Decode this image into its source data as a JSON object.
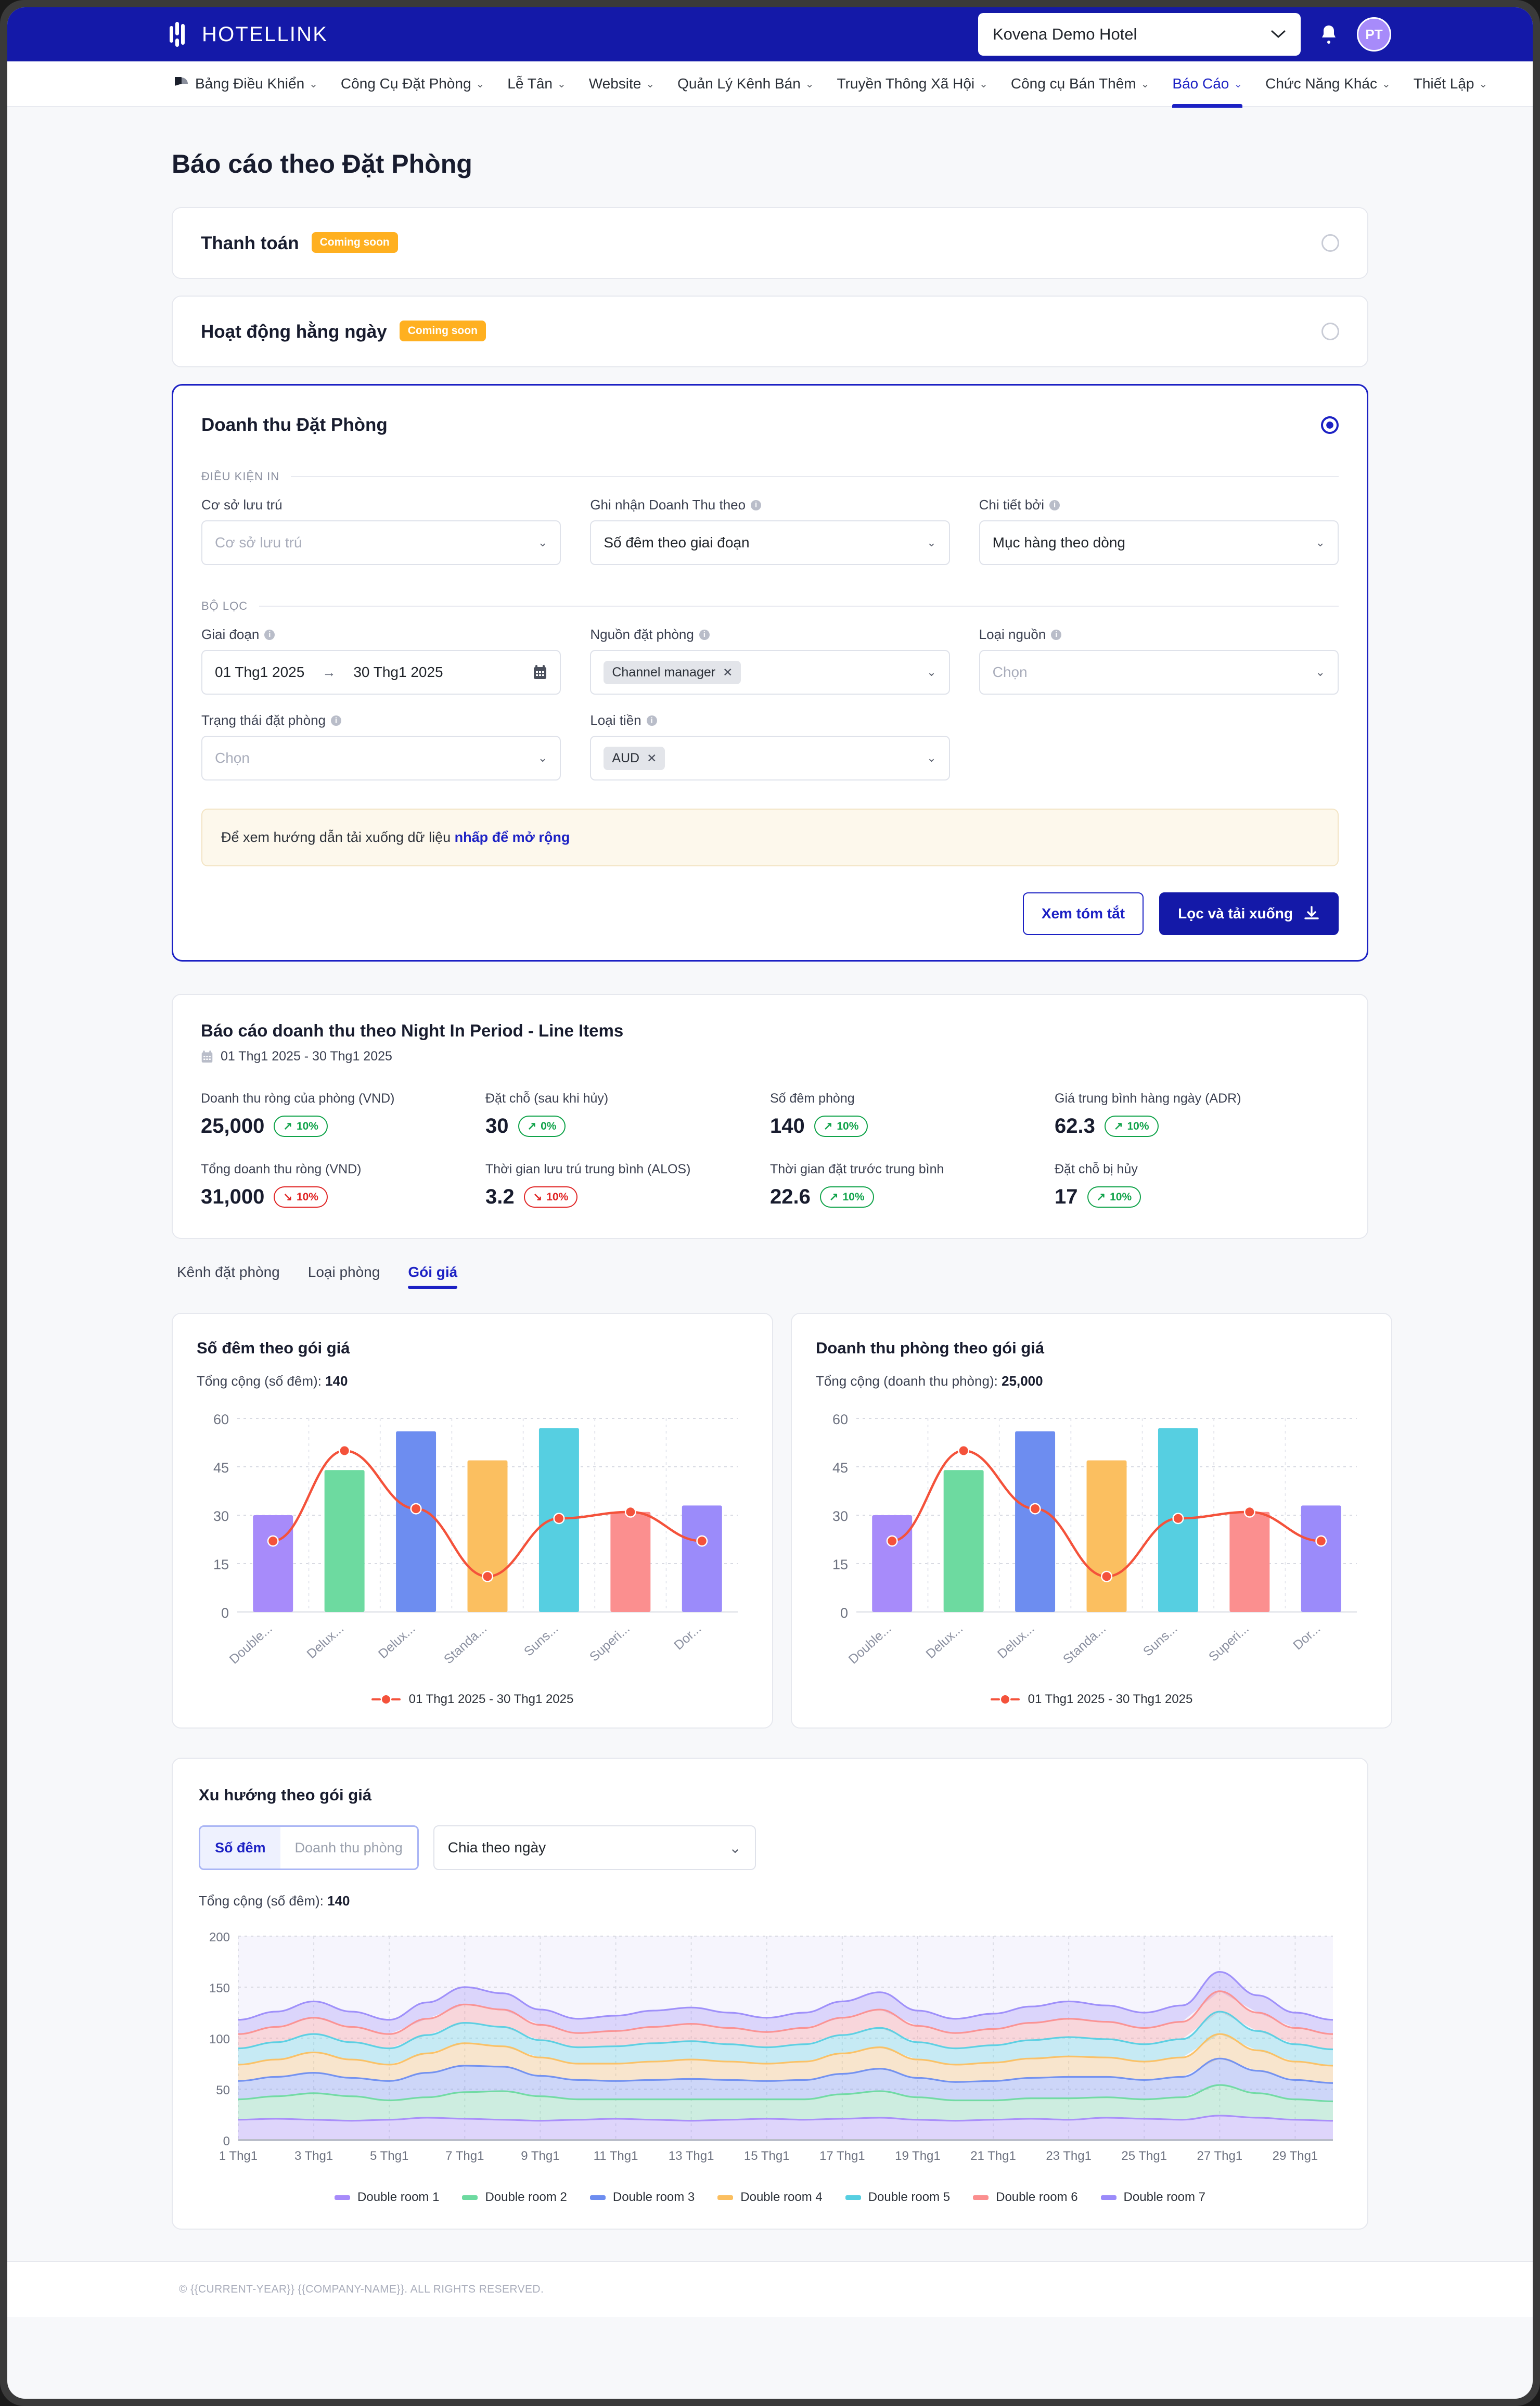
{
  "topbar": {
    "brand": "HOTELLINK",
    "hotel_selected": "Kovena Demo Hotel",
    "avatar_initials": "PT"
  },
  "nav": {
    "items": [
      {
        "label": "Bảng Điều Khiển",
        "caret": true,
        "icon": "dashboard-pie-icon",
        "active": false
      },
      {
        "label": "Công Cụ Đặt Phòng",
        "caret": true,
        "active": false
      },
      {
        "label": "Lễ Tân",
        "caret": true,
        "active": false
      },
      {
        "label": "Website",
        "caret": true,
        "active": false
      },
      {
        "label": "Quản Lý Kênh Bán",
        "caret": true,
        "active": false
      },
      {
        "label": "Truyền Thông Xã Hội",
        "caret": true,
        "active": false
      },
      {
        "label": "Công cụ Bán Thêm",
        "caret": true,
        "active": false
      },
      {
        "label": "Báo Cáo",
        "caret": true,
        "active": true
      },
      {
        "label": "Chức Năng Khác",
        "caret": true,
        "active": false
      },
      {
        "label": "Thiết Lập",
        "caret": true,
        "active": false
      }
    ]
  },
  "page": {
    "title": "Báo cáo theo Đặt Phòng"
  },
  "accordions": [
    {
      "title": "Thanh toán",
      "badge": "Coming soon",
      "selected": false
    },
    {
      "title": "Hoạt động hằng ngày",
      "badge": "Coming soon",
      "selected": false
    }
  ],
  "panel": {
    "title": "Doanh thu Đặt Phòng",
    "selected": true,
    "print_legend": "ĐIỀU KIỆN IN",
    "filter_legend": "BỘ LỌC",
    "fields": {
      "property": {
        "label": "Cơ sở lưu trú",
        "placeholder": "Cơ sở lưu trú",
        "value": ""
      },
      "revenue_basis": {
        "label": "Ghi nhận Doanh Thu theo",
        "value": "Số đêm theo giai đoạn",
        "info": true
      },
      "detail_by": {
        "label": "Chi tiết bởi",
        "value": "Mục hàng theo dòng",
        "info": true
      },
      "period": {
        "label": "Giai đoạn",
        "info": true,
        "start": "01 Thg1 2025",
        "end": "30 Thg1 2025",
        "arrow": "→"
      },
      "booking_source": {
        "label": "Nguồn đặt phòng",
        "info": true,
        "chips": [
          "Channel manager"
        ]
      },
      "source_type": {
        "label": "Loại nguồn",
        "info": true,
        "placeholder": "Chọn",
        "value": ""
      },
      "booking_status": {
        "label": "Trạng thái đặt phòng",
        "info": true,
        "placeholder": "Chọn",
        "value": ""
      },
      "currency": {
        "label": "Loại tiền",
        "info": true,
        "chips": [
          "AUD"
        ]
      }
    },
    "notice": {
      "text": "Để xem hướng dẫn tải xuống dữ liệu ",
      "link": "nhấp để mở rộng"
    },
    "buttons": {
      "summary": "Xem tóm tắt",
      "download": "Lọc và tải xuống"
    }
  },
  "summary": {
    "title": "Báo cáo doanh thu theo Night In Period - Line Items",
    "date_range": "01 Thg1 2025 - 30 Thg1 2025",
    "kpis": [
      {
        "label": "Doanh thu ròng của phòng (VND)",
        "value": "25,000",
        "delta": "10%",
        "dir": "up"
      },
      {
        "label": "Đặt chỗ (sau khi hủy)",
        "value": "30",
        "delta": "0%",
        "dir": "up"
      },
      {
        "label": "Số đêm phòng",
        "value": "140",
        "delta": "10%",
        "dir": "up"
      },
      {
        "label": "Giá trung bình hàng ngày (ADR)",
        "value": "62.3",
        "delta": "10%",
        "dir": "up"
      },
      {
        "label": "Tổng doanh thu ròng (VND)",
        "value": "31,000",
        "delta": "10%",
        "dir": "down"
      },
      {
        "label": "Thời gian lưu trú trung bình (ALOS)",
        "value": "3.2",
        "delta": "10%",
        "dir": "down"
      },
      {
        "label": "Thời gian đặt trước trung bình",
        "value": "22.6",
        "delta": "10%",
        "dir": "up"
      },
      {
        "label": "Đặt chỗ bị hủy",
        "value": "17",
        "delta": "10%",
        "dir": "up"
      }
    ]
  },
  "tabs": [
    {
      "label": "Kênh đặt phòng",
      "active": false
    },
    {
      "label": "Loại phòng",
      "active": false
    },
    {
      "label": "Gói giá",
      "active": true
    }
  ],
  "trend": {
    "title": "Xu hướng theo gói giá",
    "segmented": [
      {
        "label": "Số đêm",
        "active": true
      },
      {
        "label": "Doanh thu phòng",
        "active": false
      }
    ],
    "granularity": "Chia theo ngày",
    "total_label": "Tổng cộng (số đêm):",
    "total_value": "140"
  },
  "footer": "© {{CURRENT-YEAR}} {{COMPANY-NAME}}. ALL RIGHTS RESERVED.",
  "chart_data": [
    {
      "type": "bar",
      "title": "Số đêm theo gói giá",
      "total_label": "Tổng cộng (số đêm):",
      "total_value": "140",
      "categories": [
        "Double...",
        "Delux...",
        "Delux...",
        "Standa...",
        "Suns...",
        "Superi...",
        "Dor..."
      ],
      "values": [
        30,
        44,
        56,
        47,
        57,
        31,
        33
      ],
      "bar_colors": [
        "#a78bfa",
        "#6ddaa0",
        "#6d8df0",
        "#fbbf60",
        "#56cfe1",
        "#fb8f8f",
        "#9b8bfa"
      ],
      "line_name": "01 Thg1 2025 - 30 Thg1 2025",
      "line_color": "#f4523b",
      "line_values": [
        22,
        50,
        32,
        11,
        29,
        31,
        22
      ],
      "ylim": [
        0,
        60
      ],
      "yticks": [
        0,
        15,
        30,
        45,
        60
      ],
      "grid": true,
      "legend_position": "bottom"
    },
    {
      "type": "bar",
      "title": "Doanh thu phòng theo gói giá",
      "total_label": "Tổng cộng (doanh thu phòng):",
      "total_value": "25,000",
      "categories": [
        "Double...",
        "Delux...",
        "Delux...",
        "Standa...",
        "Suns...",
        "Superi...",
        "Dor..."
      ],
      "values": [
        30,
        44,
        56,
        47,
        57,
        31,
        33
      ],
      "bar_colors": [
        "#a78bfa",
        "#6ddaa0",
        "#6d8df0",
        "#fbbf60",
        "#56cfe1",
        "#fb8f8f",
        "#9b8bfa"
      ],
      "line_name": "01 Thg1 2025 - 30 Thg1 2025",
      "line_color": "#f4523b",
      "line_values": [
        22,
        50,
        32,
        11,
        29,
        31,
        22
      ],
      "ylim": [
        0,
        60
      ],
      "yticks": [
        0,
        15,
        30,
        45,
        60
      ],
      "grid": true,
      "legend_position": "bottom"
    },
    {
      "type": "area",
      "title": "Xu hướng theo gói giá",
      "stacked": true,
      "ylim": [
        0,
        200
      ],
      "yticks": [
        0,
        50,
        100,
        150,
        200
      ],
      "grid": true,
      "legend_position": "bottom",
      "xlabels": [
        "1 Thg1",
        "3 Thg1",
        "5 Thg1",
        "7 Thg1",
        "9 Thg1",
        "11 Thg1",
        "13 Thg1",
        "15 Thg1",
        "17 Thg1",
        "19 Thg1",
        "21 Thg1",
        "23 Thg1",
        "25 Thg1",
        "27 Thg1",
        "29 Thg1"
      ],
      "x": [
        1,
        2,
        3,
        4,
        5,
        6,
        7,
        8,
        9,
        10,
        11,
        12,
        13,
        14,
        15,
        16,
        17,
        18,
        19,
        20,
        21,
        22,
        23,
        24,
        25,
        26,
        27,
        28,
        29,
        30
      ],
      "series": [
        {
          "name": "Double room 1",
          "color": "#a78bfa",
          "values": [
            20,
            21,
            20,
            19,
            20,
            22,
            21,
            20,
            19,
            20,
            21,
            20,
            19,
            20,
            21,
            20,
            21,
            22,
            20,
            19,
            20,
            21,
            20,
            22,
            21,
            20,
            24,
            22,
            20,
            19
          ]
        },
        {
          "name": "Double room 2",
          "color": "#6ddaa0",
          "values": [
            20,
            22,
            26,
            24,
            19,
            20,
            26,
            28,
            24,
            20,
            19,
            20,
            21,
            20,
            19,
            20,
            24,
            26,
            22,
            20,
            19,
            20,
            21,
            20,
            19,
            22,
            30,
            24,
            20,
            19
          ]
        },
        {
          "name": "Double room 3",
          "color": "#6d8df0",
          "values": [
            18,
            19,
            20,
            18,
            19,
            24,
            26,
            24,
            20,
            19,
            18,
            19,
            20,
            19,
            18,
            19,
            20,
            22,
            19,
            18,
            19,
            20,
            21,
            20,
            19,
            20,
            26,
            22,
            19,
            18
          ]
        },
        {
          "name": "Double room 4",
          "color": "#fbbf60",
          "values": [
            16,
            17,
            20,
            18,
            16,
            19,
            22,
            20,
            18,
            16,
            17,
            18,
            19,
            18,
            17,
            18,
            20,
            21,
            18,
            17,
            18,
            19,
            20,
            19,
            18,
            19,
            24,
            20,
            18,
            17
          ]
        },
        {
          "name": "Double room 5",
          "color": "#56cfe1",
          "values": [
            16,
            17,
            18,
            17,
            16,
            18,
            20,
            19,
            17,
            16,
            17,
            18,
            18,
            17,
            16,
            17,
            18,
            19,
            17,
            16,
            17,
            18,
            19,
            18,
            17,
            18,
            22,
            19,
            17,
            16
          ]
        },
        {
          "name": "Double room 6",
          "color": "#fb8f8f",
          "values": [
            14,
            15,
            16,
            15,
            14,
            16,
            18,
            17,
            15,
            14,
            15,
            16,
            17,
            16,
            15,
            16,
            17,
            18,
            16,
            15,
            16,
            17,
            18,
            17,
            16,
            17,
            20,
            18,
            16,
            15
          ]
        },
        {
          "name": "Double room 7",
          "color": "#9b8bfa",
          "values": [
            14,
            15,
            16,
            15,
            14,
            16,
            17,
            16,
            15,
            14,
            15,
            16,
            16,
            15,
            14,
            15,
            16,
            17,
            15,
            14,
            15,
            16,
            17,
            16,
            15,
            16,
            19,
            17,
            15,
            14
          ]
        }
      ]
    }
  ]
}
